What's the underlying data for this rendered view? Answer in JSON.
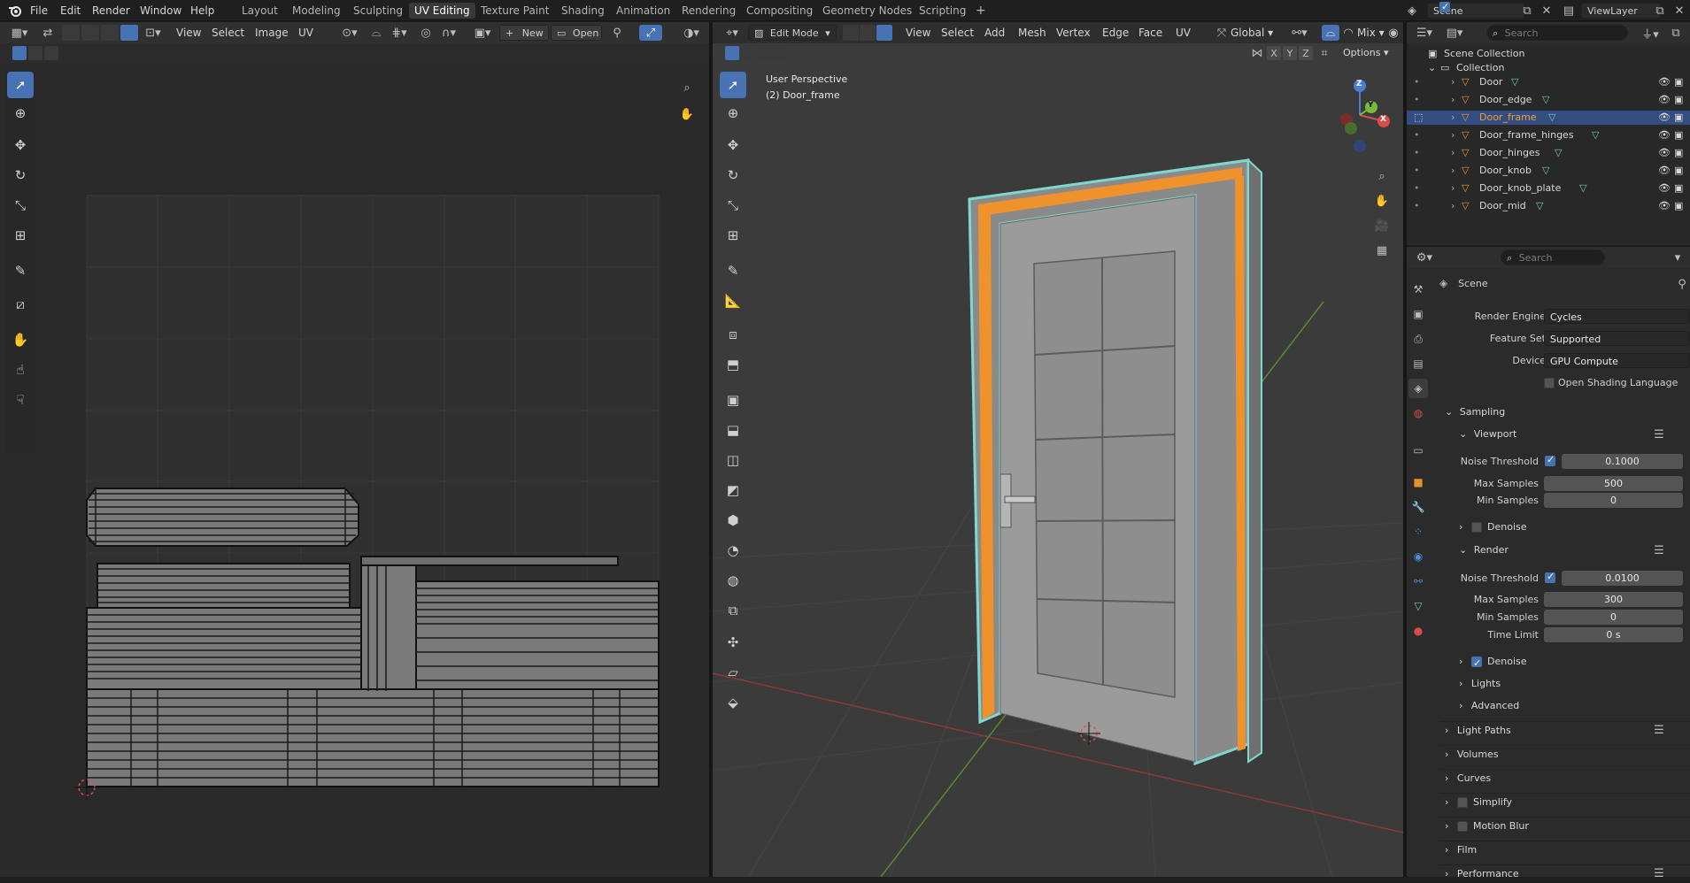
{
  "topbar": {
    "menus": [
      "File",
      "Edit",
      "Render",
      "Window",
      "Help"
    ],
    "workspaces": [
      "Layout",
      "Modeling",
      "Sculpting",
      "UV Editing",
      "Texture Paint",
      "Shading",
      "Animation",
      "Rendering",
      "Compositing",
      "Geometry Nodes",
      "Scripting"
    ],
    "active_workspace": "UV Editing",
    "add_tab": "+",
    "scene": "Scene",
    "view_layer": "ViewLayer"
  },
  "uv_editor": {
    "menus": [
      "View",
      "Select",
      "Image",
      "UV"
    ],
    "new_label": "New",
    "open_label": "Open"
  },
  "viewport": {
    "mode": "Edit Mode",
    "menus": [
      "View",
      "Select",
      "Add",
      "Mesh",
      "Vertex",
      "Edge",
      "Face",
      "UV"
    ],
    "transform_orientation": "Global",
    "shading_mix": "Mix",
    "options_label": "Options",
    "axes": [
      "X",
      "Y",
      "Z"
    ],
    "overlay_title": "User Perspective",
    "overlay_object": "(2) Door_frame",
    "gizmo_axes": {
      "z": "Z",
      "y": "Y",
      "x": "X"
    }
  },
  "outliner": {
    "search_placeholder": "Search",
    "root": "Scene Collection",
    "collection": "Collection",
    "items": [
      {
        "name": "Door",
        "selected": false
      },
      {
        "name": "Door_edge",
        "selected": false
      },
      {
        "name": "Door_frame",
        "selected": true
      },
      {
        "name": "Door_frame_hinges",
        "selected": false
      },
      {
        "name": "Door_hinges",
        "selected": false
      },
      {
        "name": "Door_knob",
        "selected": false
      },
      {
        "name": "Door_knob_plate",
        "selected": false
      },
      {
        "name": "Door_mid",
        "selected": false
      }
    ]
  },
  "properties": {
    "search_placeholder": "Search",
    "context": "Scene",
    "render_engine_label": "Render Engine",
    "render_engine": "Cycles",
    "feature_set_label": "Feature Set",
    "feature_set": "Supported",
    "device_label": "Device",
    "device": "GPU Compute",
    "osl_label": "Open Shading Language",
    "sampling": "Sampling",
    "viewport": {
      "title": "Viewport",
      "noise_threshold_label": "Noise Threshold",
      "noise_threshold": "0.1000",
      "max_samples_label": "Max Samples",
      "max_samples": "500",
      "min_samples_label": "Min Samples",
      "min_samples": "0",
      "denoise_label": "Denoise"
    },
    "render": {
      "title": "Render",
      "noise_threshold_label": "Noise Threshold",
      "noise_threshold": "0.0100",
      "max_samples_label": "Max Samples",
      "max_samples": "300",
      "min_samples_label": "Min Samples",
      "min_samples": "0",
      "time_limit_label": "Time Limit",
      "time_limit": "0 s",
      "denoise_label": "Denoise"
    },
    "lights": "Lights",
    "advanced": "Advanced",
    "light_paths": "Light Paths",
    "volumes": "Volumes",
    "curves": "Curves",
    "simplify": "Simplify",
    "motion_blur": "Motion Blur",
    "film": "Film",
    "performance": "Performance"
  },
  "colors": {
    "accent": "#4772b3",
    "selection_orange": "#f0922c",
    "mesh_cyan": "#7fd8d0"
  }
}
